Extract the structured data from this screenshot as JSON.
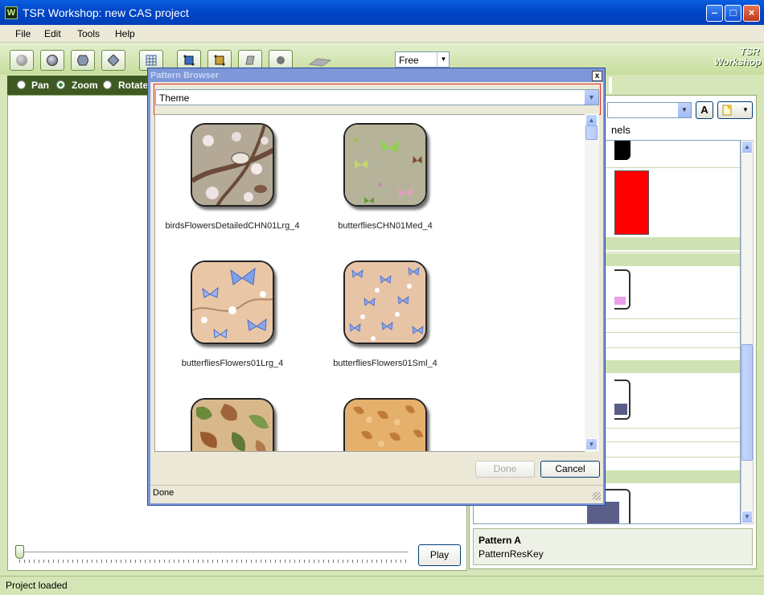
{
  "window": {
    "title": "TSR Workshop: new CAS project",
    "app_icon_letter": "W"
  },
  "menu": [
    "File",
    "Edit",
    "Tools",
    "Help"
  ],
  "toolbar": {
    "mode_select_value": "Free",
    "logo_line1": "TSR",
    "logo_line2": "Workshop"
  },
  "viewport": {
    "radio_options": [
      {
        "label": "Pan",
        "selected": false
      },
      {
        "label": "Zoom",
        "selected": true
      },
      {
        "label": "Rotate",
        "selected": false
      }
    ],
    "play_label": "Play"
  },
  "right_panel": {
    "font_button": "A",
    "channels_label": "nels",
    "selected_title": "Pattern A",
    "selected_sub": "PatternResKey",
    "swatch_color": "#ff0000"
  },
  "dialog": {
    "title": "Pattern Browser",
    "close": "x",
    "theme_value": "Theme",
    "patterns": [
      {
        "name": "birdsFlowersDetailedCHN01Lrg_4"
      },
      {
        "name": "butterfliesCHN01Med_4"
      },
      {
        "name": "butterfliesFlowers01Lrg_4"
      },
      {
        "name": "butterfliesFlowers01Sml_4"
      },
      {
        "name": ""
      },
      {
        "name": ""
      }
    ],
    "done_label": "Done",
    "cancel_label": "Cancel",
    "status": "Done"
  },
  "status_bar": {
    "text": "Project loaded"
  }
}
